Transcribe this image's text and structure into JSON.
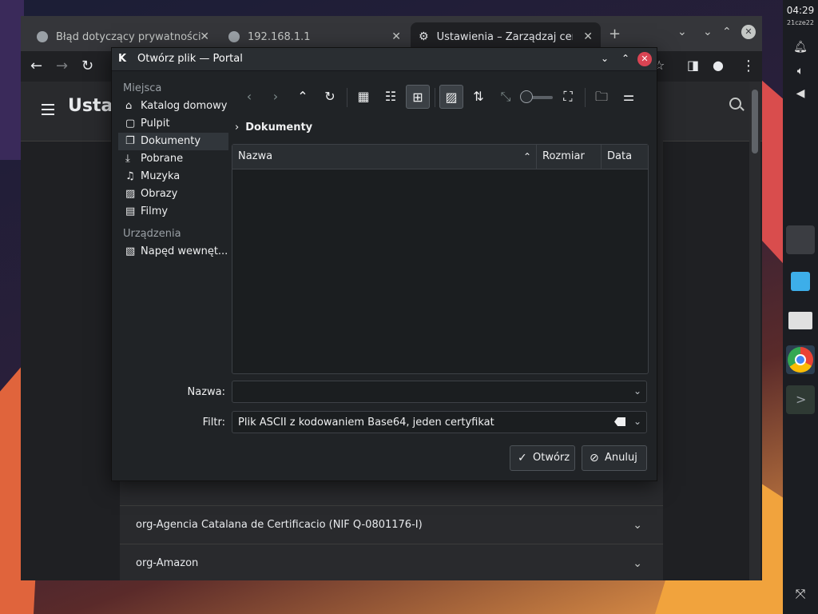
{
  "panel": {
    "clock": "04:29",
    "date": "21cze22"
  },
  "browser": {
    "tabs": [
      {
        "label": "Błąd dotyczący prywatności"
      },
      {
        "label": "192.168.1.1"
      },
      {
        "label": "Ustawienia – Zarządzaj certyfikatami"
      }
    ],
    "page_title": "Ustawienia",
    "cert_rows": [
      {
        "label": "org-Agencia Catalana de Certificacio (NIF Q-0801176-I)"
      },
      {
        "label": "org-Amazon"
      }
    ]
  },
  "dialog": {
    "logo": "K",
    "title": "Otwórz plik — Portal",
    "places_header": "Miejsca",
    "places": [
      {
        "icon": "home-icon",
        "glyph": "⌂",
        "label": "Katalog domowy"
      },
      {
        "icon": "desktop-icon",
        "glyph": "▢",
        "label": "Pulpit"
      },
      {
        "icon": "documents-icon",
        "glyph": "❐",
        "label": "Dokumenty"
      },
      {
        "icon": "download-icon",
        "glyph": "⤓",
        "label": "Pobrane"
      },
      {
        "icon": "music-icon",
        "glyph": "♫",
        "label": "Muzyka"
      },
      {
        "icon": "pictures-icon",
        "glyph": "▨",
        "label": "Obrazy"
      },
      {
        "icon": "video-icon",
        "glyph": "▤",
        "label": "Filmy"
      }
    ],
    "devices_header": "Urządzenia",
    "devices": [
      {
        "icon": "drive-icon",
        "glyph": "▧",
        "label": "Napęd wewnęt..."
      }
    ],
    "breadcrumb": "Dokumenty",
    "columns": {
      "name": "Nazwa",
      "size": "Rozmiar",
      "date": "Data"
    },
    "name_label": "Nazwa:",
    "name_value": "",
    "filter_label": "Filtr:",
    "filter_value": "Plik ASCII z kodowaniem Base64, jeden certyfikat",
    "open_button": "Otwórz",
    "cancel_button": "Anuluj"
  }
}
